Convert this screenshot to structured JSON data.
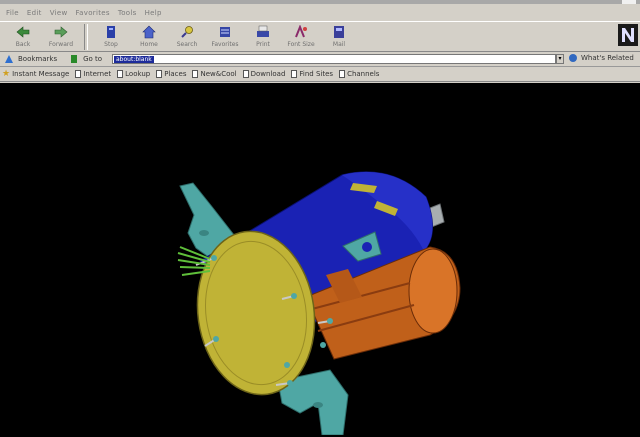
{
  "menu": {
    "items": [
      "File",
      "Edit",
      "View",
      "Favorites",
      "Tools",
      "Help"
    ]
  },
  "toolbar": {
    "buttons": [
      {
        "label": "Back",
        "icon": "back-arrow-icon"
      },
      {
        "label": "Forward",
        "icon": "forward-arrow-icon"
      },
      {
        "label": "Stop",
        "icon": "stop-icon"
      },
      {
        "label": "Home",
        "icon": "home-icon"
      },
      {
        "label": "Search",
        "icon": "search-icon"
      },
      {
        "label": "Favorites",
        "icon": "favorites-icon"
      },
      {
        "label": "Print",
        "icon": "print-icon"
      },
      {
        "label": "Font Size",
        "icon": "font-size-icon"
      },
      {
        "label": "Mail",
        "icon": "mail-icon"
      }
    ]
  },
  "addressbar": {
    "label1": "Bookmarks",
    "label2": "Go to",
    "url": "about:blank",
    "links_label": "What's Related"
  },
  "links": [
    "Instant Message",
    "Internet",
    "Lookup",
    "Places",
    "New&Cool",
    "Download",
    "Find Sites",
    "Channels"
  ],
  "colors": {
    "canvas": "#000000",
    "body_blue": "#1a22b4",
    "endplate": "#c0b336",
    "motor": "#c0601a",
    "bracket": "#4fa7a4"
  }
}
